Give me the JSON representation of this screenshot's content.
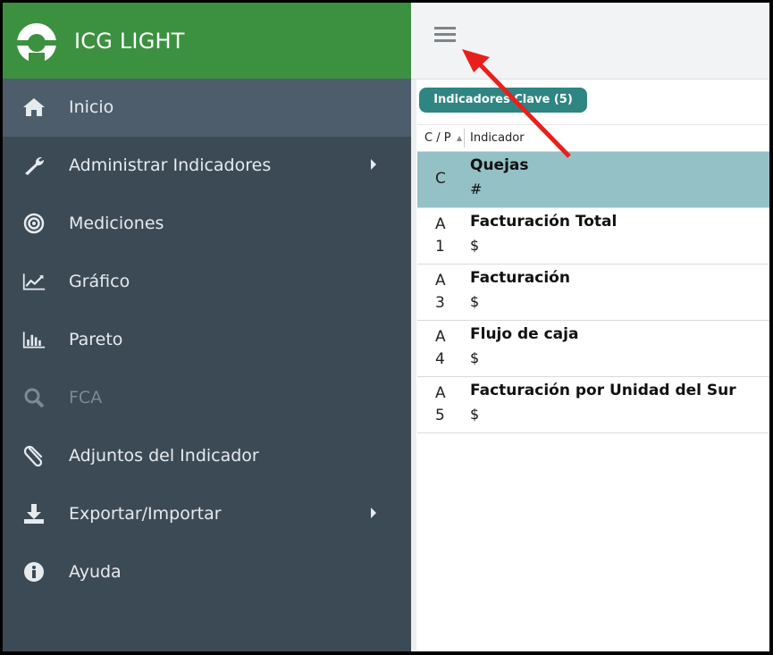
{
  "brand": {
    "title": "ICG LIGHT",
    "color": "#3c9140"
  },
  "sidebar": {
    "items": [
      {
        "label": "Inicio",
        "icon": "home-icon",
        "active": true
      },
      {
        "label": "Administrar Indicadores",
        "icon": "wrench-icon",
        "submenu": true
      },
      {
        "label": "Mediciones",
        "icon": "target-icon"
      },
      {
        "label": "Gráfico",
        "icon": "line-chart-icon"
      },
      {
        "label": "Pareto",
        "icon": "bar-chart-icon"
      },
      {
        "label": "FCA",
        "icon": "search-icon",
        "disabled": true
      },
      {
        "label": "Adjuntos del Indicador",
        "icon": "paperclip-icon"
      },
      {
        "label": "Exportar/Importar",
        "icon": "download-icon",
        "submenu": true
      },
      {
        "label": "Ayuda",
        "icon": "info-icon"
      }
    ]
  },
  "topbar": {
    "menu_icon": "hamburger-icon"
  },
  "tab": {
    "label": "Indicadores Clave (5)"
  },
  "table": {
    "headers": {
      "cp": "C / P",
      "indicator": "Indicador"
    },
    "rows": [
      {
        "cp1": "C",
        "cp2": "",
        "name": "Quejas",
        "unit": "#",
        "selected": true
      },
      {
        "cp1": "A",
        "cp2": "1",
        "name": "Facturación Total",
        "unit": "$"
      },
      {
        "cp1": "A",
        "cp2": "3",
        "name": "Facturación",
        "unit": "$"
      },
      {
        "cp1": "A",
        "cp2": "4",
        "name": "Flujo de caja",
        "unit": "$"
      },
      {
        "cp1": "A",
        "cp2": "5",
        "name": "Facturación por Unidad del Sur",
        "unit": "$"
      }
    ]
  },
  "annotation": {
    "arrow_color": "#e8201c"
  }
}
